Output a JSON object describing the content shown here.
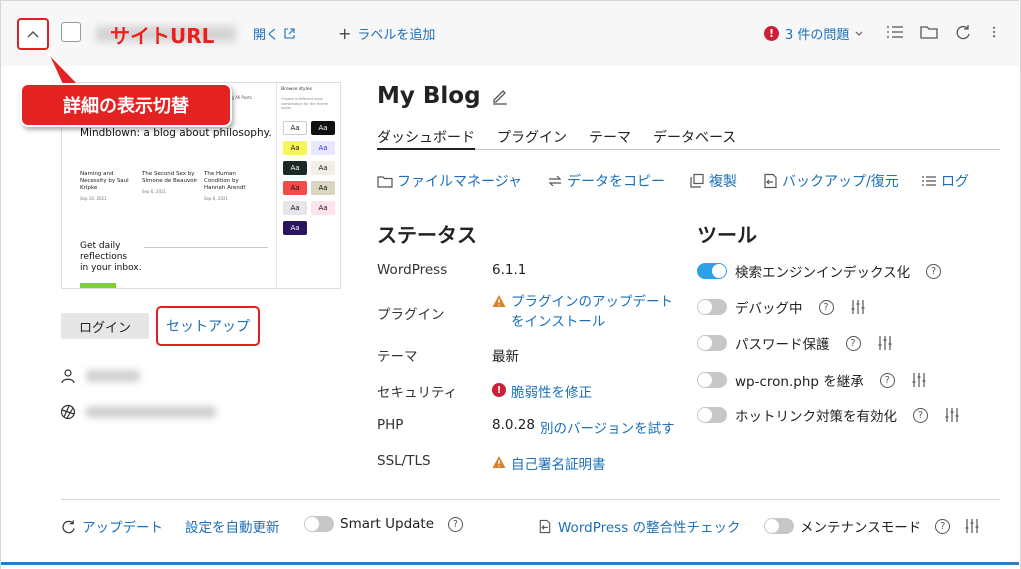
{
  "header": {
    "site_url_label": "サイトURL",
    "open_label": "開く",
    "add_label": "ラベルを追加",
    "issues_label": "3 件の問題",
    "issues_icon": "!"
  },
  "callout": {
    "text": "詳細の表示切替"
  },
  "preview": {
    "nav": "Home   Blog   All Posts",
    "headline": "Mindblown: a blog about philosophy.",
    "columns": [
      {
        "title": "Naming and Necessity by Saul Kripke",
        "date": "Sep 10, 2021"
      },
      {
        "title": "The Second Sex by Simone de Beauvoir",
        "date": "Sep 6, 2021"
      },
      {
        "title": "The Human Condition by Hannah Arendt",
        "date": "Sep 6, 2021"
      }
    ],
    "cta_line1": "Get daily",
    "cta_line2": "reflections",
    "cta_line3": "in your inbox.",
    "panel_title": "Browse styles",
    "panel_sub": "Choose a different style combination for the theme styles",
    "swatch_text": "Aa"
  },
  "left": {
    "login_label": "ログイン",
    "setup_label": "セットアップ"
  },
  "site": {
    "title": "My Blog"
  },
  "tabs": [
    {
      "label": "ダッシュボード"
    },
    {
      "label": "プラグイン"
    },
    {
      "label": "テーマ"
    },
    {
      "label": "データベース"
    }
  ],
  "actions": [
    {
      "label": "ファイルマネージャ"
    },
    {
      "label": "データをコピー"
    },
    {
      "label": "複製"
    },
    {
      "label": "バックアップ/復元"
    },
    {
      "label": "ログ"
    }
  ],
  "status": {
    "heading": "ステータス",
    "rows": [
      {
        "label": "WordPress",
        "value": "6.1.1"
      },
      {
        "label": "プラグイン",
        "value_line1": "プラグインのアップデート",
        "value_line2": "をインストール"
      },
      {
        "label": "テーマ",
        "value": "最新"
      },
      {
        "label": "セキュリティ",
        "value": "脆弱性を修正"
      },
      {
        "label": "PHP",
        "value": "8.0.28",
        "link": "別のバージョンを試す"
      },
      {
        "label": "SSL/TLS",
        "value": "自己署名証明書"
      }
    ]
  },
  "tools": {
    "heading": "ツール",
    "items": [
      {
        "label": "検索エンジンインデックス化",
        "on": true
      },
      {
        "label": "デバッグ中",
        "on": false
      },
      {
        "label": "パスワード保護",
        "on": false
      },
      {
        "label": "wp-cron.php を継承",
        "on": false
      },
      {
        "label": "ホットリンク対策を有効化",
        "on": false
      }
    ]
  },
  "footer": {
    "update_label": "アップデート",
    "auto_update_label": "設定を自動更新",
    "smart_update_label": "Smart Update",
    "integrity_label": "WordPress の整合性チェック",
    "maintenance_label": "メンテナンスモード"
  },
  "help_glyph": "?"
}
